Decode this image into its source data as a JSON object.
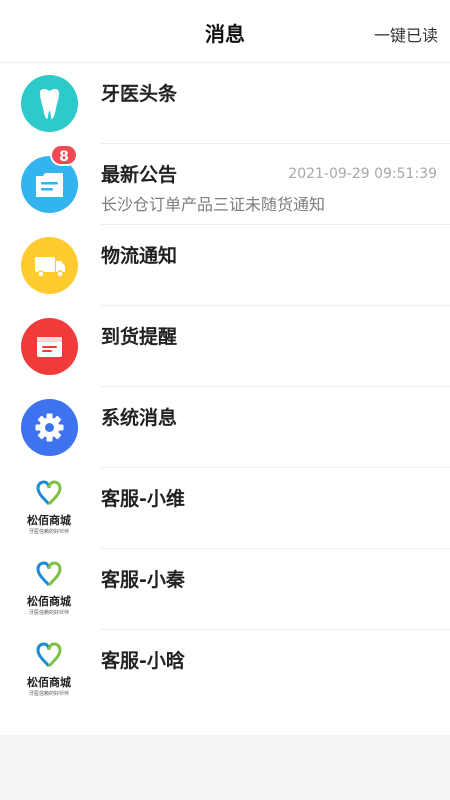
{
  "header": {
    "title": "消息",
    "read_all": "一键已读"
  },
  "items": [
    {
      "name": "牙医头条",
      "icon": "tooth-icon",
      "color": "#2ec9c9"
    },
    {
      "name": "最新公告",
      "icon": "announcement-icon",
      "color": "#33b4ef",
      "badge": "8",
      "time": "2021-09-29 09:51:39",
      "subtitle": "长沙仓订单产品三证未随货通知"
    },
    {
      "name": "物流通知",
      "icon": "truck-icon",
      "color": "#ffcb2f"
    },
    {
      "name": "到货提醒",
      "icon": "package-icon",
      "color": "#f13b3b"
    },
    {
      "name": "系统消息",
      "icon": "gear-icon",
      "color": "#3d73ee"
    },
    {
      "name": "客服-小维",
      "icon": "brand-logo"
    },
    {
      "name": "客服-小秦",
      "icon": "brand-logo"
    },
    {
      "name": "客服-小晗",
      "icon": "brand-logo"
    }
  ],
  "brand": {
    "name": "松佰商城",
    "slogan": "牙医信赖的好伙伴",
    "colors": {
      "blue": "#1a8cd8",
      "green": "#7cc242"
    }
  }
}
